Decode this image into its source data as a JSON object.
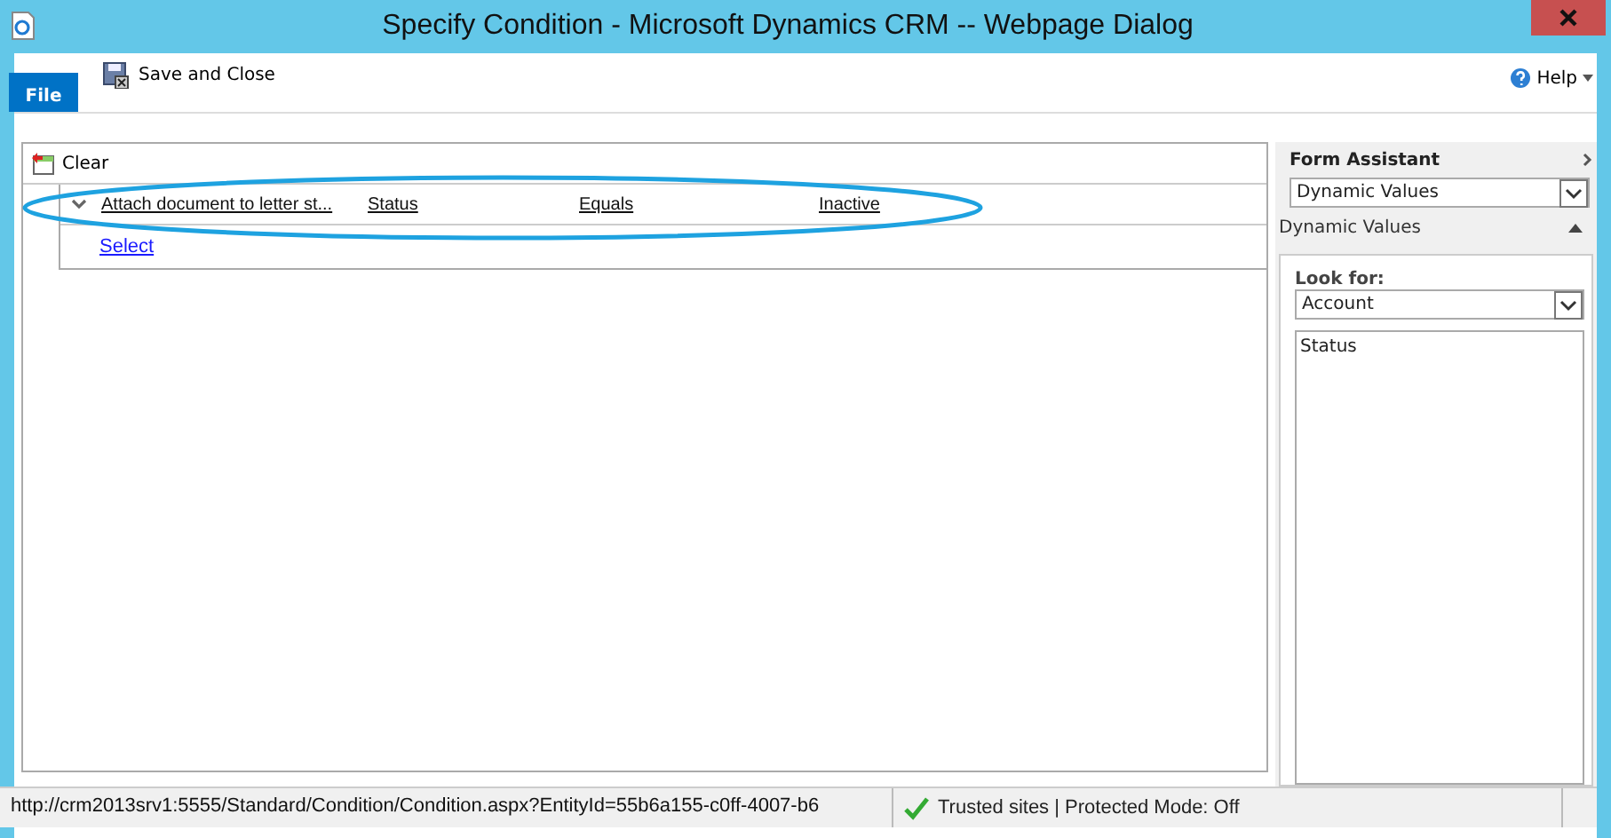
{
  "window": {
    "title": "Specify Condition - Microsoft Dynamics CRM -- Webpage Dialog"
  },
  "ribbon": {
    "file_tab": "File",
    "buttons": [
      {
        "label": "Save and Close"
      }
    ],
    "help": "Help"
  },
  "condition": {
    "clear": "Clear",
    "rows": [
      {
        "field": "Attach document to letter st...",
        "attribute": "Status",
        "operator": "Equals",
        "value": "Inactive",
        "highlighted": true
      }
    ],
    "select": "Select"
  },
  "assistant": {
    "title": "Form Assistant",
    "mode": "Dynamic Values",
    "section": {
      "title": "Dynamic Values",
      "expanded": true
    },
    "look_for_label": "Look for:",
    "look_for": "Account",
    "values": [
      {
        "label": "Status"
      }
    ]
  },
  "status_bar": {
    "url": "http://crm2013srv1:5555/Standard/Condition/Condition.aspx?EntityId=55b6a155-c0ff-4007-b6",
    "zone": "Trusted sites | Protected Mode: Off"
  }
}
